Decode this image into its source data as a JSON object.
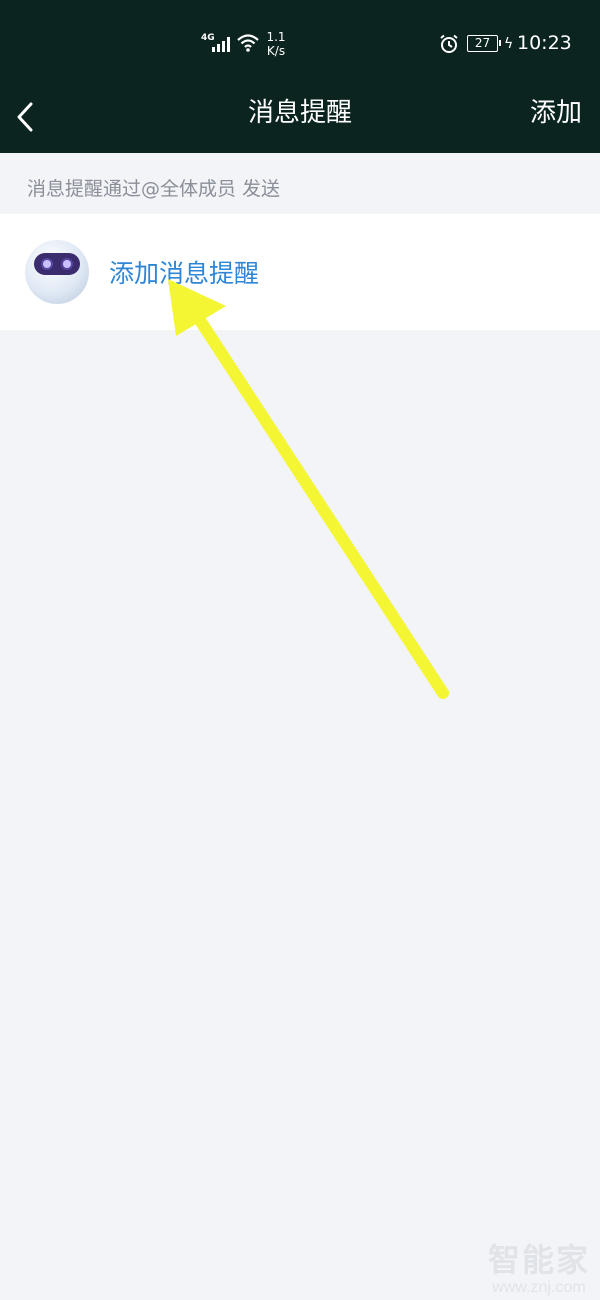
{
  "status_bar": {
    "network": "4G",
    "speed": "1.1",
    "speed_unit": "K/s",
    "battery": "27",
    "time": "10:23"
  },
  "nav": {
    "back_icon": "chevron-left-icon",
    "title": "消息提醒",
    "add_label": "添加"
  },
  "hint_text": "消息提醒通过@全体成员 发送",
  "list": {
    "items": [
      {
        "label": "添加消息提醒",
        "icon": "robot-avatar"
      }
    ]
  },
  "annotation": {
    "color": "#f4f533"
  },
  "watermark": {
    "logo": "智能家",
    "url": "www.znj.com"
  }
}
